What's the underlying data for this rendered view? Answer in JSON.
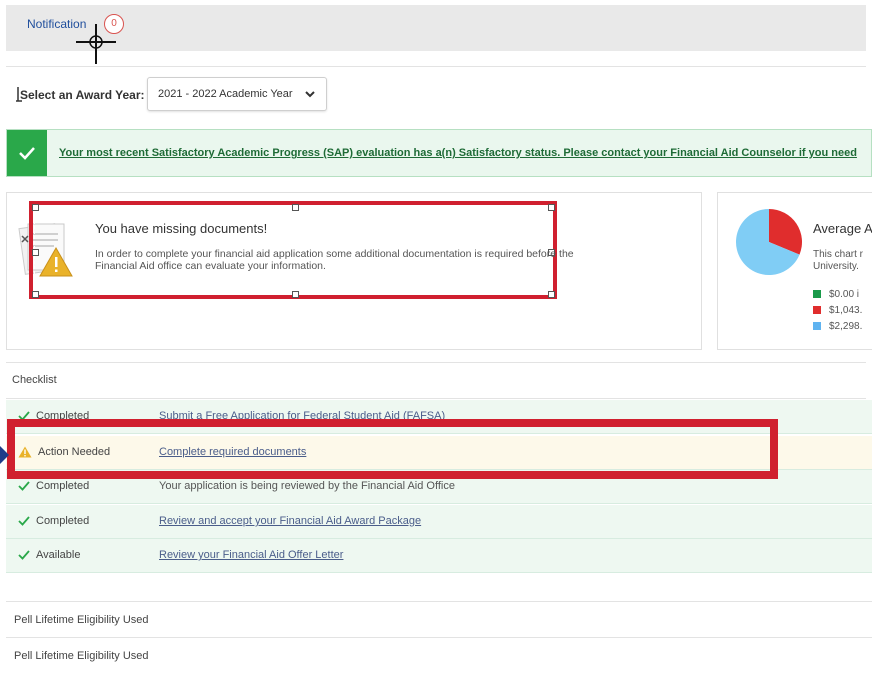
{
  "header": {
    "notification_label": "Notification",
    "notification_count": "0"
  },
  "award": {
    "label": "Select an Award Year:",
    "selected": "2021 - 2022 Academic Year"
  },
  "sap_banner": {
    "text": "Your most recent Satisfactory Academic Progress (SAP) evaluation has a(n) Satisfactory status. Please contact your Financial Aid Counselor if you need"
  },
  "missing_docs": {
    "title": "You have missing documents!",
    "body": "In order to complete your financial aid application some additional documentation is required before the Financial Aid office can evaluate your information."
  },
  "chart": {
    "title": "Average A",
    "desc_line1": "This chart r",
    "desc_line2": "University.",
    "legend": [
      {
        "label": "$0.00 i",
        "color": "#1a9a4a"
      },
      {
        "label": "$1,043.",
        "color": "#e02d2d"
      },
      {
        "label": "$2,298.",
        "color": "#5fb3f0"
      }
    ]
  },
  "chart_data": {
    "type": "pie",
    "categories": [
      "$0.00",
      "$1,043.",
      "$2,298."
    ],
    "values": [
      0,
      1043,
      2298
    ],
    "title": "Average A",
    "colors": [
      "#1a9a4a",
      "#e02d2d",
      "#80cdf5"
    ]
  },
  "checklist": {
    "heading": "Checklist",
    "items": [
      {
        "status": "Completed",
        "text": "Submit a Free Application for Federal Student Aid (FAFSA)"
      },
      {
        "status": "Action Needed",
        "text": "Complete required documents"
      },
      {
        "status": "Completed",
        "text": "Your application is being reviewed by the Financial Aid Office"
      },
      {
        "status": "Completed",
        "text": "Review and accept your Financial Aid Award Package"
      },
      {
        "status": "Available",
        "text": "Review your Financial Aid Offer Letter"
      }
    ]
  },
  "pell": [
    "Pell Lifetime Eligibility Used",
    "Pell Lifetime Eligibility Used"
  ]
}
